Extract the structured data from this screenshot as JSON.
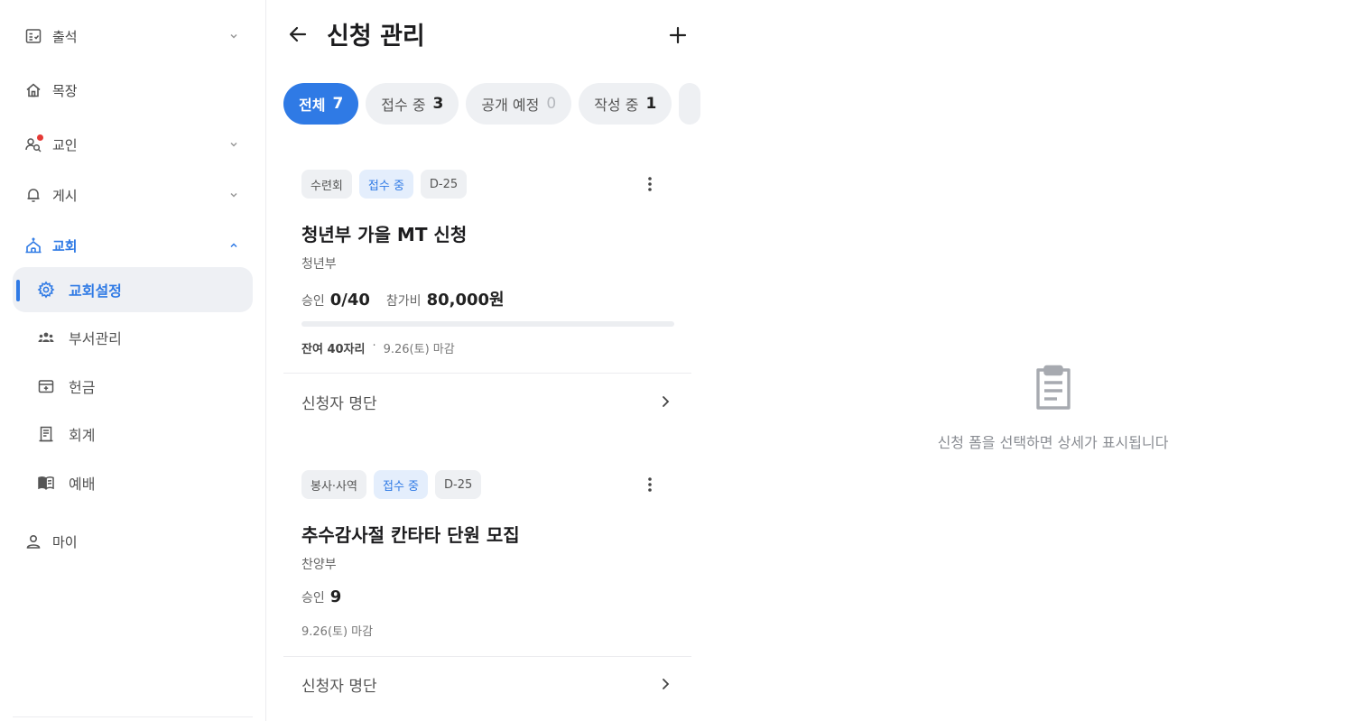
{
  "sidebar": {
    "items": [
      {
        "label": "출석",
        "icon": "attendance-icon"
      },
      {
        "label": "목장",
        "icon": "home-icon"
      },
      {
        "label": "교인",
        "icon": "members-search-icon"
      },
      {
        "label": "게시",
        "icon": "bell-icon"
      },
      {
        "label": "교회",
        "icon": "church-icon"
      },
      {
        "label": "마이",
        "icon": "user-icon"
      }
    ],
    "church_sub": [
      {
        "label": "교회설정",
        "icon": "gear-icon"
      },
      {
        "label": "부서관리",
        "icon": "group-icon"
      },
      {
        "label": "헌금",
        "icon": "offering-icon"
      },
      {
        "label": "회계",
        "icon": "ledger-icon"
      },
      {
        "label": "예배",
        "icon": "book-icon"
      }
    ]
  },
  "header": {
    "title": "신청 관리"
  },
  "filters": [
    {
      "label": "전체",
      "count": "7"
    },
    {
      "label": "접수 중",
      "count": "3"
    },
    {
      "label": "공개 예정",
      "count": "0"
    },
    {
      "label": "작성 중",
      "count": "1"
    }
  ],
  "cards": [
    {
      "tags": [
        "수련회",
        "접수 중",
        "D-25"
      ],
      "title": "청년부 가을 MT 신청",
      "dept": "청년부",
      "approved_label": "승인",
      "approved_value": "0/40",
      "fee_label": "참가비",
      "fee_value": "80,000원",
      "progress": 0.0,
      "remaining": "잔여 40자리",
      "sep": "·",
      "deadline": "9.26(토) 마감",
      "roster_label": "신청자 명단"
    },
    {
      "tags": [
        "봉사·사역",
        "접수 중",
        "D-25"
      ],
      "title": "추수감사절 칸타타 단원 모집",
      "dept": "찬양부",
      "approved_label": "승인",
      "approved_value": "9",
      "deadline": "9.26(토) 마감",
      "roster_label": "신청자 명단"
    }
  ],
  "detail": {
    "empty_text": "신청 폼을 선택하면 상세가 표시됩니다"
  },
  "colors": {
    "accent": "#2f7ae5",
    "chip_bg": "#eef0f3",
    "tag_blue_bg": "#e4eefc",
    "badge_red": "#e53935"
  }
}
